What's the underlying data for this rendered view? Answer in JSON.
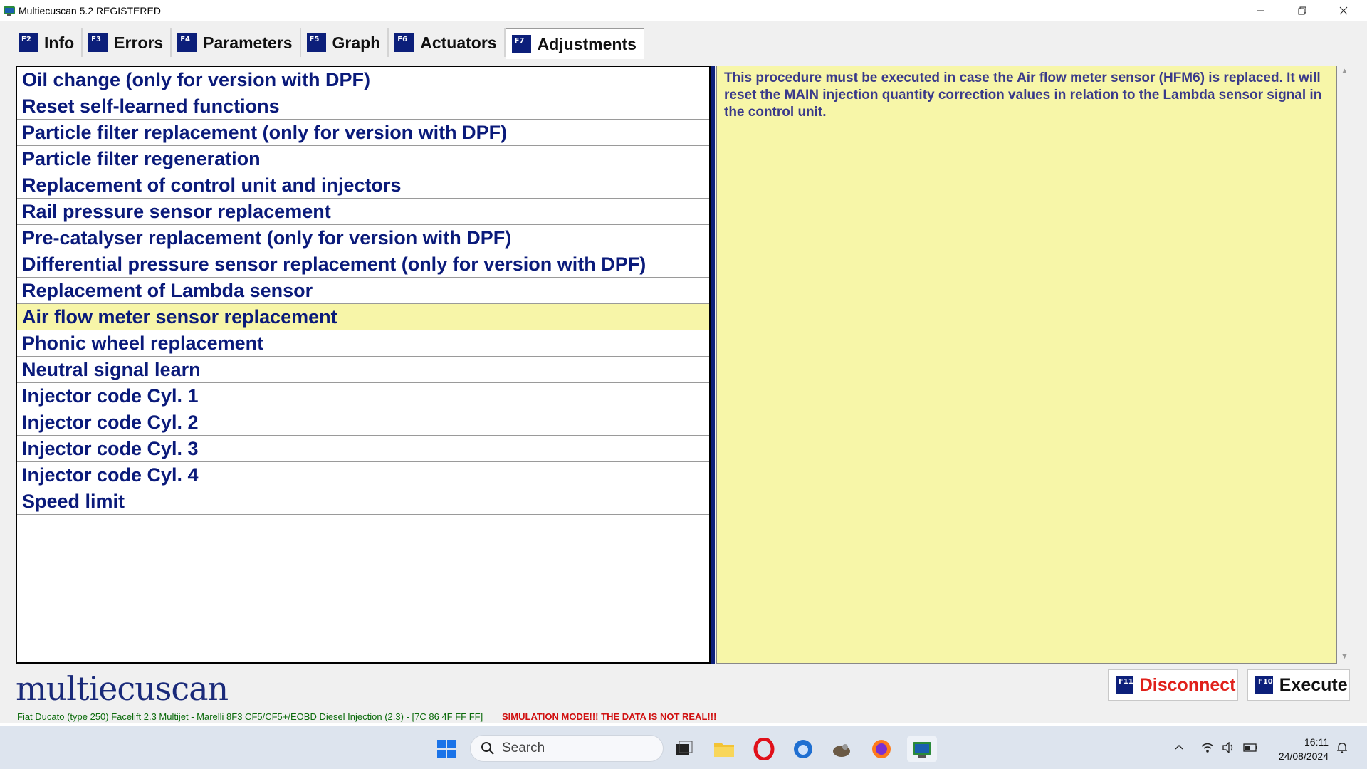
{
  "window": {
    "title": "Multiecuscan 5.2 REGISTERED",
    "controls": [
      "minimize-icon",
      "restore-icon",
      "close-icon"
    ]
  },
  "tabs": [
    {
      "key": "F2",
      "label": "Info",
      "active": false
    },
    {
      "key": "F3",
      "label": "Errors",
      "active": false
    },
    {
      "key": "F4",
      "label": "Parameters",
      "active": false
    },
    {
      "key": "F5",
      "label": "Graph",
      "active": false
    },
    {
      "key": "F6",
      "label": "Actuators",
      "active": false
    },
    {
      "key": "F7",
      "label": "Adjustments",
      "active": true
    }
  ],
  "adjustments": {
    "items": [
      "Oil change (only for version with DPF)",
      "Reset self-learned functions",
      "Particle filter replacement (only for version with DPF)",
      "Particle filter regeneration",
      "Replacement of control unit and injectors",
      "Rail pressure sensor replacement",
      "Pre-catalyser replacement (only for version with DPF)",
      "Differential pressure sensor replacement (only for version with DPF)",
      "Replacement of Lambda sensor",
      "Air flow meter sensor replacement",
      "Phonic wheel replacement",
      "Neutral signal learn",
      "Injector code Cyl. 1",
      "Injector code Cyl. 2",
      "Injector code Cyl. 3",
      "Injector code Cyl. 4",
      "Speed limit"
    ],
    "selected_index": 9,
    "description": "This procedure must be executed in case the Air flow meter sensor (HFM6) is replaced. It will reset the MAIN injection quantity correction values in relation to the Lambda sensor signal in the control unit."
  },
  "logo_text": "multiecuscan",
  "actions": {
    "disconnect": {
      "key": "F11",
      "label": "Disconnect",
      "color": "#e0201a"
    },
    "execute": {
      "key": "F10",
      "label": "Execute",
      "color": "#111111"
    }
  },
  "status": {
    "vehicle": "Fiat Ducato (type 250) Facelift 2.3 Multijet - Marelli 8F3 CF5/CF5+/EOBD Diesel Injection (2.3) - [7C 86 4F FF FF]",
    "warning": "SIMULATION MODE!!! THE DATA IS NOT REAL!!!"
  },
  "taskbar": {
    "search_placeholder": "Search",
    "apps": [
      "windows-start-icon",
      "search-icon",
      "task-view-icon",
      "file-explorer-icon",
      "opera-icon",
      "thunderbird-icon",
      "gimp-icon",
      "firefox-icon",
      "multiecuscan-icon"
    ],
    "time": "16:11",
    "date": "24/08/2024"
  },
  "colors": {
    "accent_blue": "#0c1f7a",
    "selection_yellow": "#f7f5a8",
    "list_text": "#0a1a7a",
    "vehicle_status": "#0a6a0a",
    "warning_red": "#d01010"
  }
}
